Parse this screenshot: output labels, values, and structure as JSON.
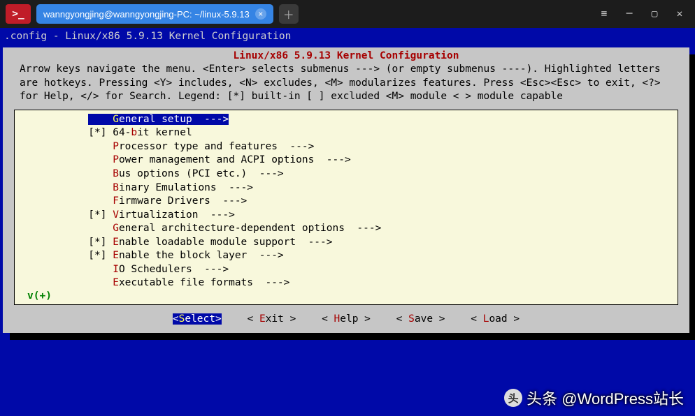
{
  "titlebar": {
    "tab_title": "wanngyongjing@wanngyongjing-PC: ~/linux-5.9.13"
  },
  "terminal": {
    "title_line": ".config - Linux/x86 5.9.13 Kernel Configuration",
    "panel_title": "Linux/x86 5.9.13 Kernel Configuration",
    "help_text": "Arrow keys navigate the menu.  <Enter> selects submenus ---> (or empty submenus ----).  Highlighted letters are hotkeys.  Pressing <Y> includes, <N> excludes, <M> modularizes features.  Press <Esc><Esc> to exit, <?> for Help, </> for Search.  Legend: [*] built-in  [ ] excluded  <M> module  < > module capable",
    "menu": [
      {
        "prefix": "    ",
        "hot": "G",
        "rest": "eneral setup  --->",
        "selected": true
      },
      {
        "prefix": "[*] ",
        "hot": "",
        "rest_pre": "64-",
        "hot2": "b",
        "rest2": "it kernel"
      },
      {
        "prefix": "    ",
        "hot": "P",
        "rest": "rocessor type and features  --->"
      },
      {
        "prefix": "    ",
        "hot": "P",
        "rest": "ower management and ACPI options  --->"
      },
      {
        "prefix": "    ",
        "hot": "B",
        "rest": "us options (PCI etc.)  --->"
      },
      {
        "prefix": "    ",
        "hot": "B",
        "rest": "inary Emulations  --->"
      },
      {
        "prefix": "    ",
        "hot": "F",
        "rest": "irmware Drivers  --->"
      },
      {
        "prefix": "[*] ",
        "hot": "V",
        "rest": "irtualization  --->"
      },
      {
        "prefix": "    ",
        "hot": "G",
        "rest": "eneral architecture-dependent options  --->"
      },
      {
        "prefix": "[*] ",
        "hot": "E",
        "rest": "nable loadable module support  --->"
      },
      {
        "prefix": "[*] ",
        "hot": "E",
        "rest": "nable the block layer  --->"
      },
      {
        "prefix": "    ",
        "hot": "I",
        "rest": "O Schedulers  --->"
      },
      {
        "prefix": "    ",
        "hot": "E",
        "rest": "xecutable file formats  --->"
      }
    ],
    "more_indicator": "v(+)",
    "buttons": {
      "select": {
        "open": "<",
        "hot": "S",
        "rest": "elect>"
      },
      "exit": {
        "open": "< ",
        "hot": "E",
        "rest": "xit >"
      },
      "help": {
        "open": "< ",
        "hot": "H",
        "rest": "elp >"
      },
      "save": {
        "open": "< ",
        "hot": "S",
        "rest": "ave >"
      },
      "load": {
        "open": "< ",
        "hot": "L",
        "rest": "oad >"
      }
    }
  },
  "watermark": "头条 @WordPress站长"
}
